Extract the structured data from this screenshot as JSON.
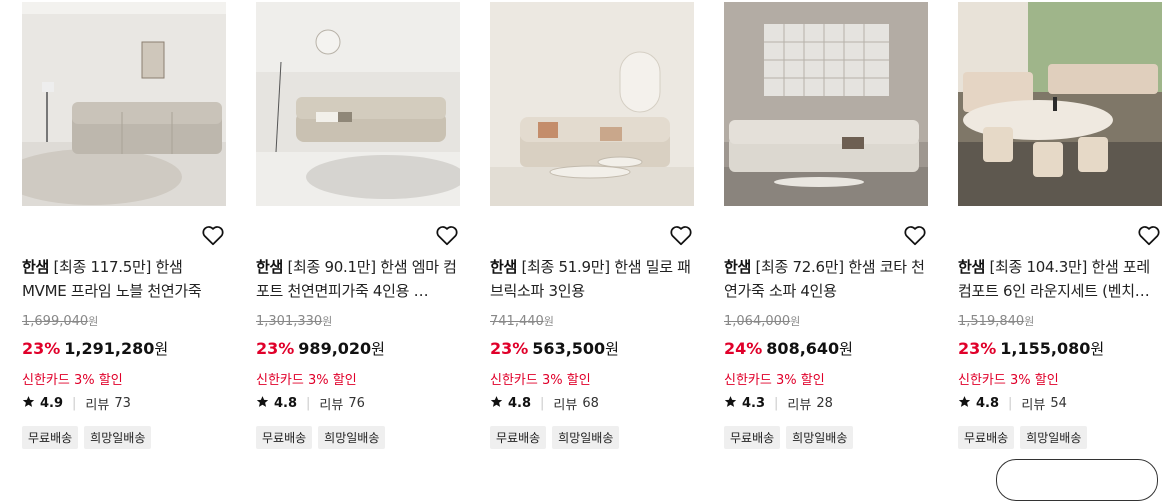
{
  "products": [
    {
      "brand": "한샘",
      "title": "[최종 117.5만] 한샘 MVME 프라임 노블 천연가죽 리…",
      "original_price": "1,699,040",
      "won_unit": "원",
      "discount_rate": "23%",
      "sale_price": "1,291,280",
      "promo": "신한카드 3% 할인",
      "rating": "4.9",
      "review_label": "리뷰",
      "review_count": "73",
      "tags": [
        "무료배송",
        "희망일배송"
      ],
      "icon": "heart-icon"
    },
    {
      "brand": "한샘",
      "title": "[최종 90.1만] 한샘 엠마 컴포트 천연면피가죽 4인용 …",
      "original_price": "1,301,330",
      "won_unit": "원",
      "discount_rate": "23%",
      "sale_price": "989,020",
      "promo": "신한카드 3% 할인",
      "rating": "4.8",
      "review_label": "리뷰",
      "review_count": "76",
      "tags": [
        "무료배송",
        "희망일배송"
      ],
      "icon": "heart-icon"
    },
    {
      "brand": "한샘",
      "title": "[최종 51.9만] 한샘 밀로 패브릭소파 3인용",
      "original_price": "741,440",
      "won_unit": "원",
      "discount_rate": "23%",
      "sale_price": "563,500",
      "promo": "신한카드 3% 할인",
      "rating": "4.8",
      "review_label": "리뷰",
      "review_count": "68",
      "tags": [
        "무료배송",
        "희망일배송"
      ],
      "icon": "heart-icon"
    },
    {
      "brand": "한샘",
      "title": "[최종 72.6만] 한샘 코타 천연가죽 소파 4인용",
      "original_price": "1,064,000",
      "won_unit": "원",
      "discount_rate": "24%",
      "sale_price": "808,640",
      "promo": "신한카드 3% 할인",
      "rating": "4.3",
      "review_label": "리뷰",
      "review_count": "28",
      "tags": [
        "무료배송",
        "희망일배송"
      ],
      "icon": "heart-icon"
    },
    {
      "brand": "한샘",
      "title": "[최종 104.3만] 한샘 포레 컴포트 6인 라운지세트 (벤치…",
      "original_price": "1,519,840",
      "won_unit": "원",
      "discount_rate": "23%",
      "sale_price": "1,155,080",
      "promo": "신한카드 3% 할인",
      "rating": "4.8",
      "review_label": "리뷰",
      "review_count": "54",
      "tags": [
        "무료배송",
        "희망일배송"
      ],
      "icon": "heart-icon"
    }
  ],
  "colors": {
    "accent": "#e0002a",
    "tag_bg": "#efefef",
    "muted": "#888888"
  }
}
